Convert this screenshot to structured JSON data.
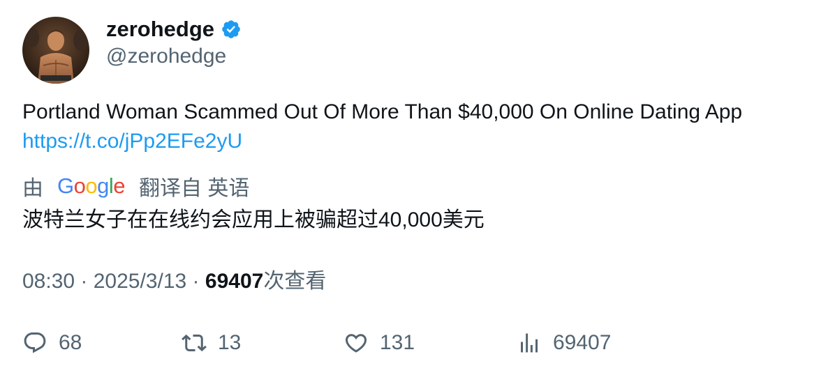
{
  "author": {
    "display_name": "zerohedge",
    "handle": "@zerohedge",
    "verified": true,
    "verified_color": "#1d9bf0",
    "avatar_icon": "profile-photo"
  },
  "tweet": {
    "text": "Portland Woman Scammed Out Of More Than $40,000 On Online Dating App",
    "link": "https://t.co/jPp2EFe2yU"
  },
  "translation": {
    "prefix": "由",
    "google_letters": [
      "G",
      "o",
      "o",
      "g",
      "l",
      "e"
    ],
    "suffix": "翻译自 英语",
    "text": "波特兰女子在在线约会应用上被骗超过40,000美元"
  },
  "meta": {
    "time": "08:30",
    "separator": " · ",
    "date": "2025/3/13",
    "views_count": "69407",
    "views_label": "次查看"
  },
  "actions": {
    "replies": "68",
    "retweets": "13",
    "likes": "131",
    "views": "69407"
  },
  "colors": {
    "text_primary": "#0f1419",
    "text_secondary": "#536471",
    "link": "#1d9bf0"
  }
}
